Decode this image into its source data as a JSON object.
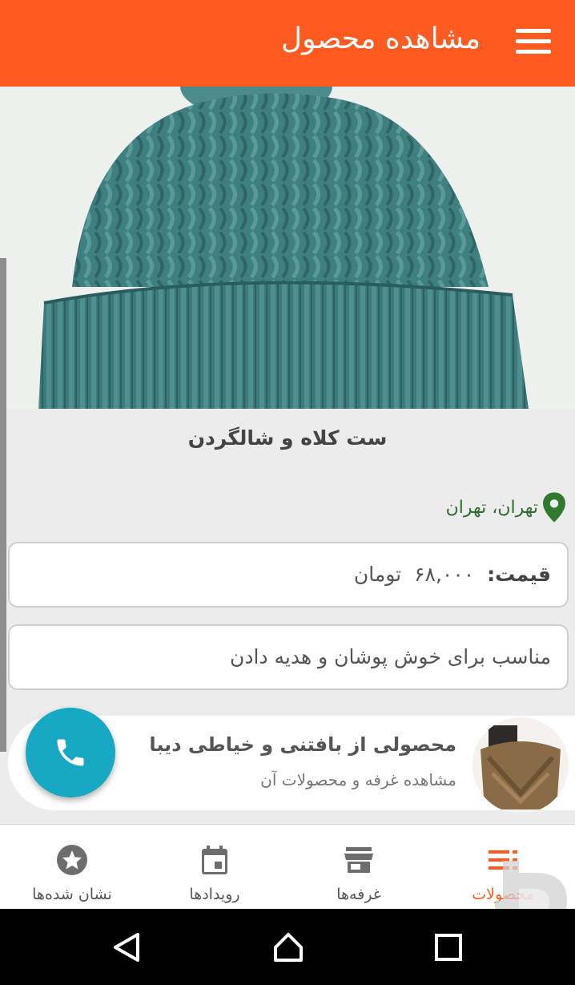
{
  "header": {
    "title": "مشاهده محصول",
    "menu_icon": "hamburger-menu-icon"
  },
  "product": {
    "name": "ست کلاه و شالگردن",
    "location": "تهران، تهران",
    "price_label": "قیمت:",
    "price_value": "۶۸,۰۰۰",
    "currency": "تومان",
    "description": "مناسب برای خوش پوشان و هدیه دادن"
  },
  "seller": {
    "title": "محصولی از بافتنی و خیاطی دیبا",
    "subtitle": "مشاهده غرفه و محصولات آن"
  },
  "bottom_nav": {
    "items": [
      {
        "label": "محصولات",
        "icon": "list-icon",
        "active": true
      },
      {
        "label": "غرفه‌ها",
        "icon": "store-icon",
        "active": false
      },
      {
        "label": "رویدادها",
        "icon": "calendar-icon",
        "active": false
      },
      {
        "label": "نشان شده‌ها",
        "icon": "star-icon",
        "active": false
      }
    ]
  },
  "colors": {
    "primary": "#ff5a1f",
    "fab": "#17a9c3",
    "location": "#2f6b2f"
  }
}
